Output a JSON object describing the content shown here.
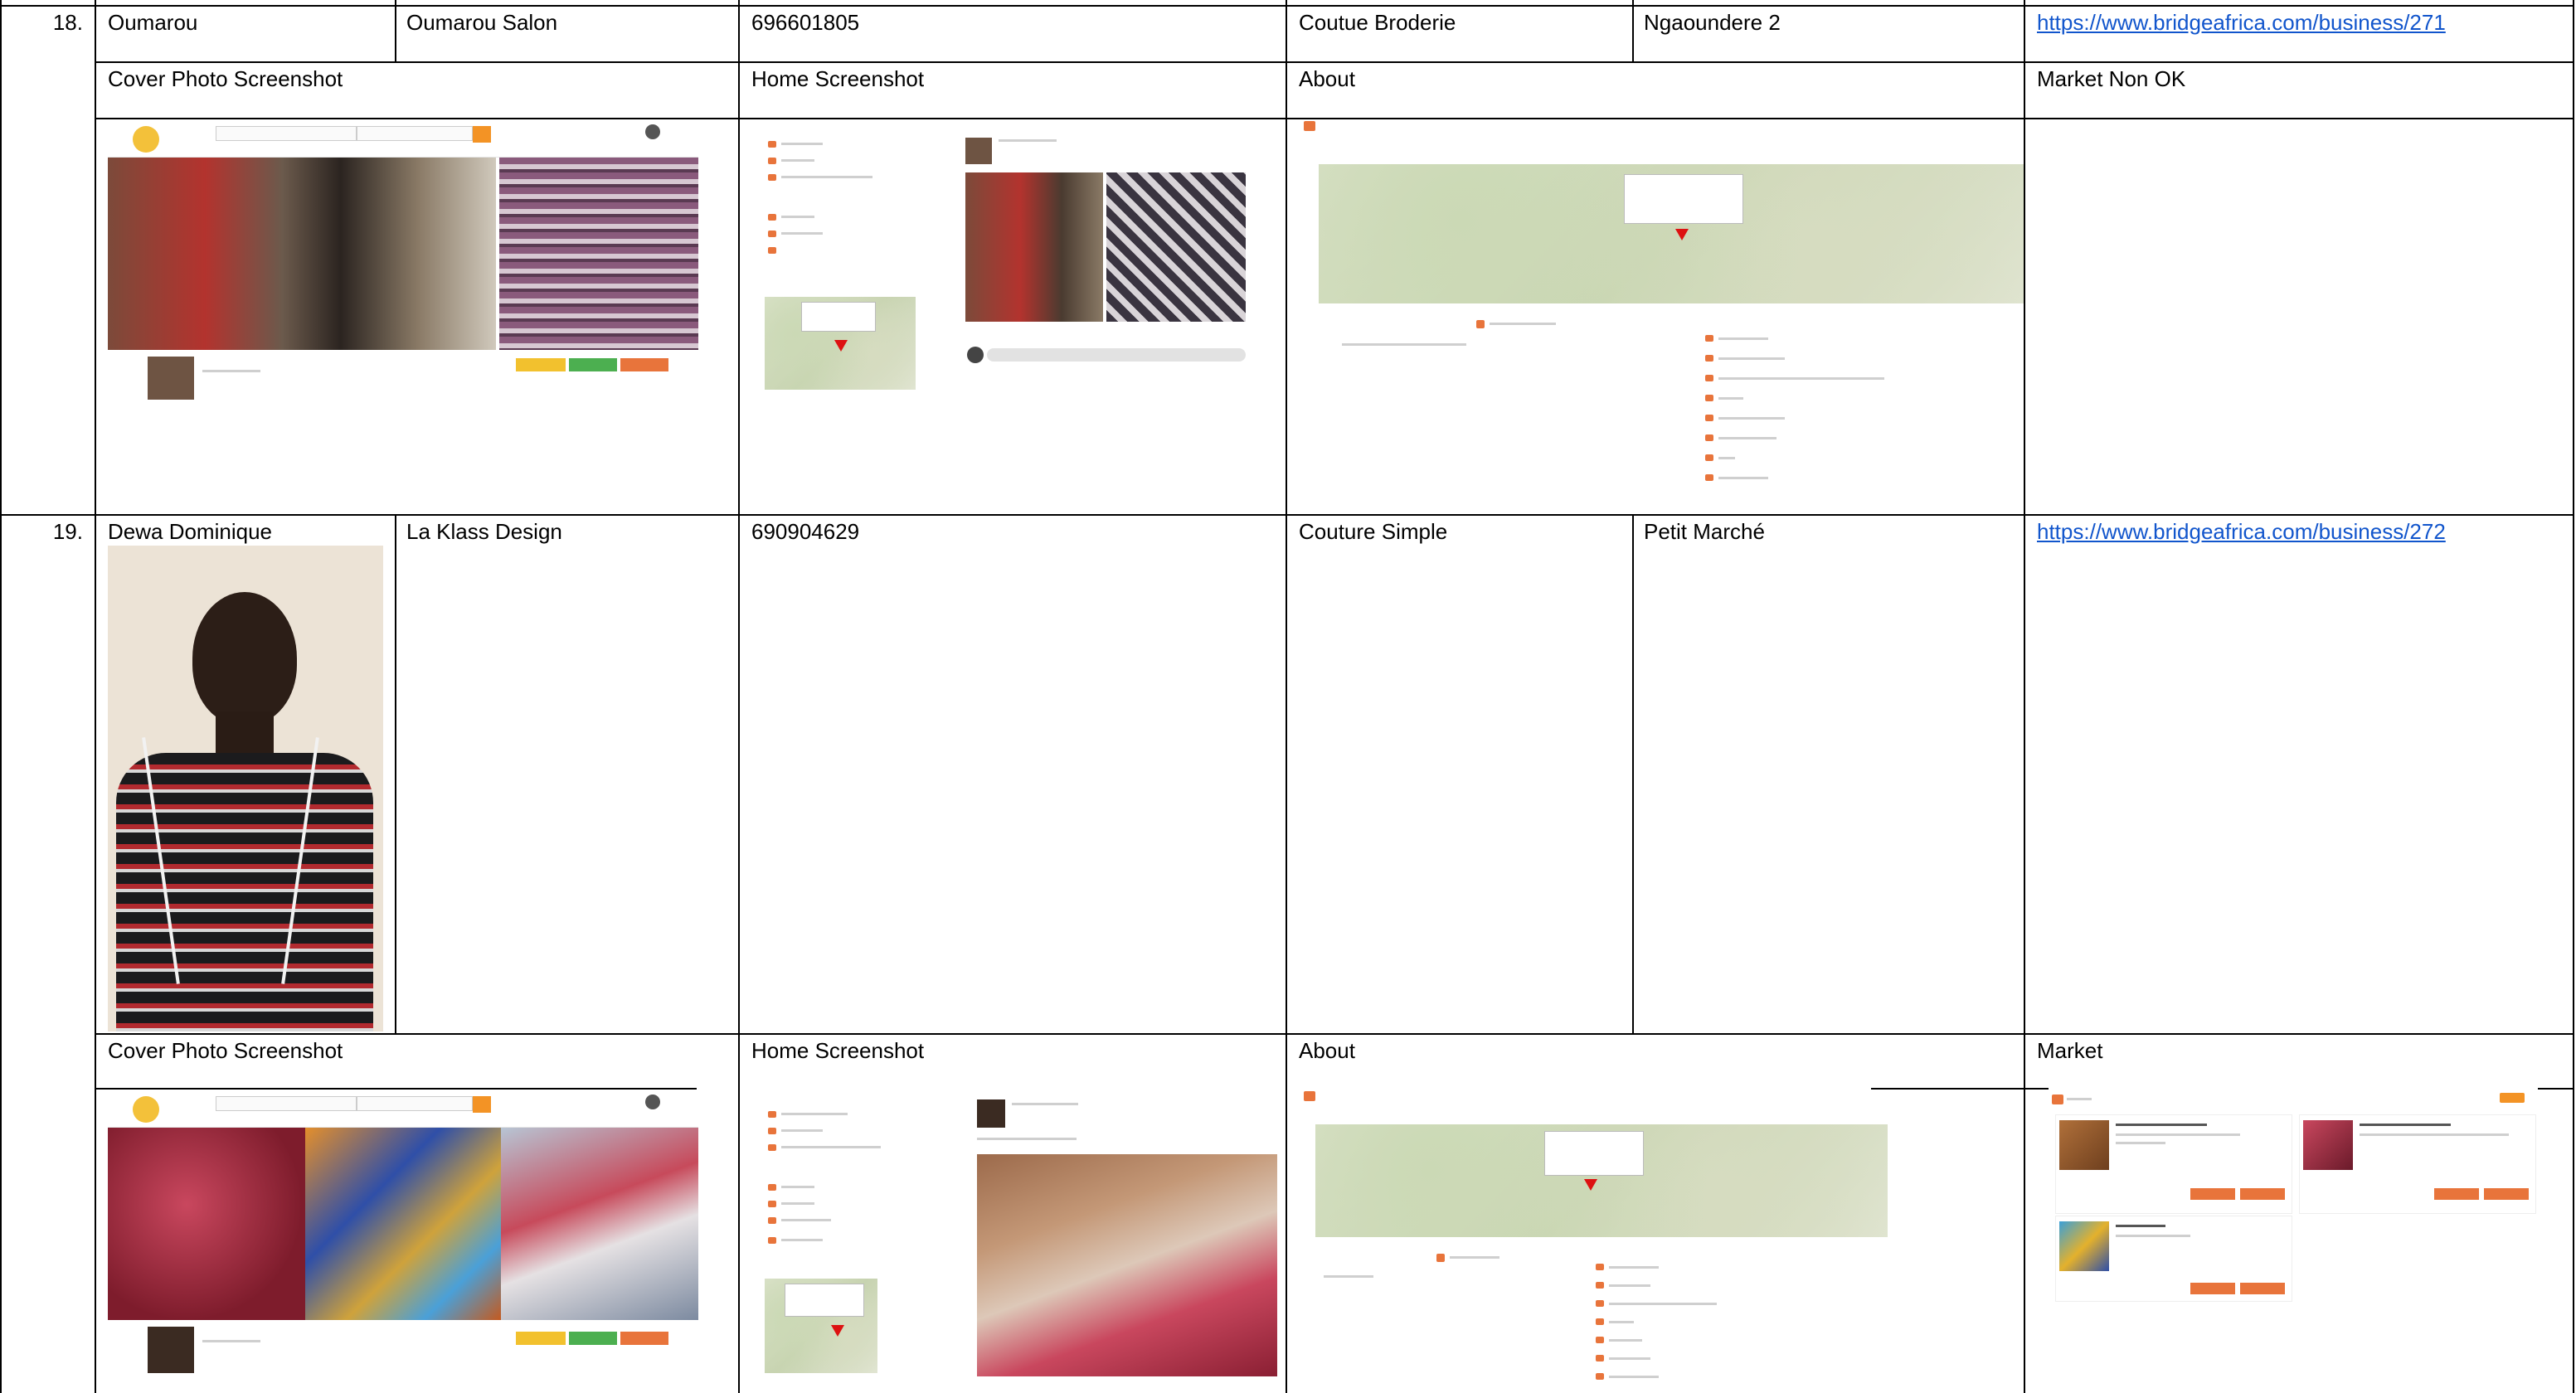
{
  "row18": {
    "num": "18.",
    "name": "Oumarou",
    "business": "Oumarou Salon",
    "phone": "696601805",
    "category": "Coutue Broderie",
    "location": "Ngaoundere 2",
    "url": "https://www.bridgeafrica.com/business/271",
    "headers": {
      "cover": "Cover Photo Screenshot",
      "home": "Home Screenshot",
      "about": "About",
      "market": "Market Non OK"
    }
  },
  "row19": {
    "num": "19.",
    "name": "Dewa Dominique",
    "business": "La Klass Design",
    "phone": "690904629",
    "category": "Couture Simple",
    "location": "Petit Marché",
    "url": "https://www.bridgeafrica.com/business/272",
    "headers": {
      "cover": "Cover Photo Screenshot",
      "home": "Home Screenshot",
      "about": "About",
      "market": "Market"
    }
  },
  "colors": {
    "link": "#1155cc",
    "brand_orange": "#f39325",
    "pin_red": "#dd1111",
    "btn_yellow": "#f2c12e",
    "btn_green": "#4caf50"
  }
}
